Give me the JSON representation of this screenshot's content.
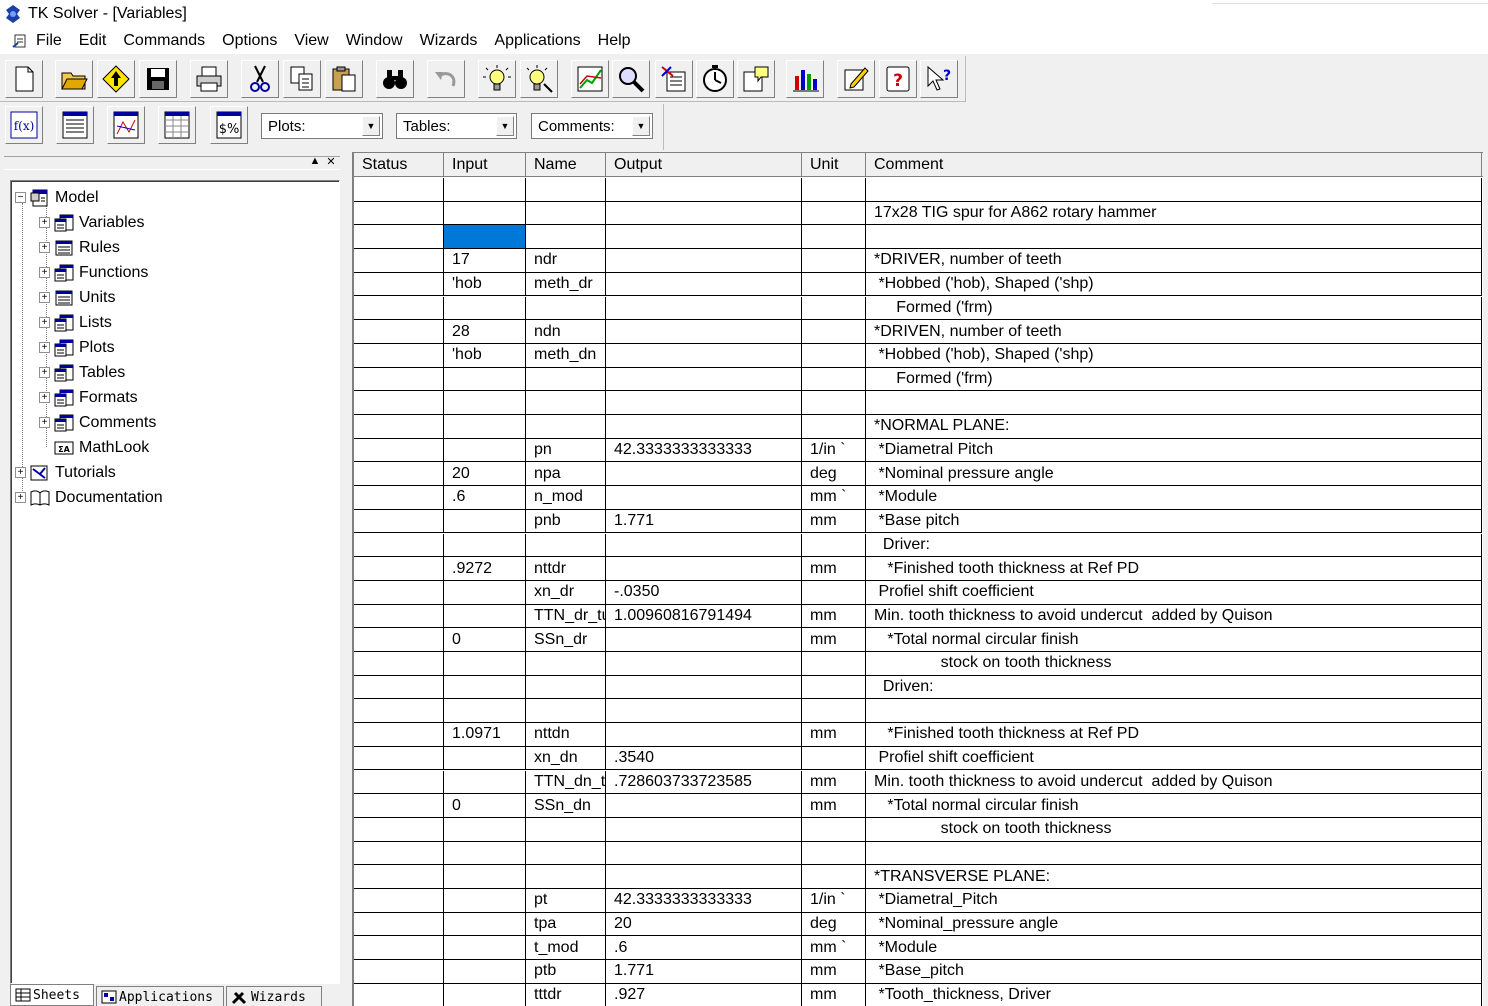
{
  "window": {
    "title": "TK Solver - [Variables]"
  },
  "menu": [
    "File",
    "Edit",
    "Commands",
    "Options",
    "View",
    "Window",
    "Wizards",
    "Applications",
    "Help"
  ],
  "toolbar": {
    "buttons": [
      "new-file-icon",
      "open-folder-icon",
      "up-arrow-icon",
      "save-icon",
      "print-icon",
      "cut-icon",
      "copy-icon",
      "paste-icon",
      "find-icon",
      "undo-icon",
      "solve-icon",
      "iterate-icon",
      "plot-icon",
      "zoom-icon",
      "list-icon",
      "timer-icon",
      "comment-icon",
      "chart-icon",
      "edit-icon",
      "help-icon",
      "context-help-icon"
    ]
  },
  "toolbar2": {
    "buttons": [
      "function-icon",
      "table-sheet-icon",
      "plot-sheet-icon",
      "blank-sheet-icon",
      "units-sheet-icon"
    ],
    "plots_combo": "Plots:",
    "tables_combo": "Tables:",
    "comments_combo": "Comments:"
  },
  "tree": {
    "root": "Model",
    "children": [
      "Variables",
      "Rules",
      "Functions",
      "Units",
      "Lists",
      "Plots",
      "Tables",
      "Formats",
      "Comments",
      "MathLook"
    ],
    "tutorials": "Tutorials",
    "documentation": "Documentation"
  },
  "tabs": {
    "sheets": "Sheets",
    "applications": "Applications",
    "wizards": "Wizards"
  },
  "sheet": {
    "columns": [
      "Status",
      "Input",
      "Name",
      "Output",
      "Unit",
      "Comment"
    ],
    "rows": [
      [
        "",
        "",
        "",
        "",
        "",
        ""
      ],
      [
        "",
        "",
        "",
        "",
        "",
        "17x28 TIG spur for A862 rotary hammer"
      ],
      [
        "",
        "",
        "",
        "",
        "",
        ""
      ],
      [
        "",
        "17",
        "ndr",
        "",
        "",
        "*DRIVER, number of teeth"
      ],
      [
        "",
        "'hob",
        "meth_dr",
        "",
        "",
        " *Hobbed ('hob), Shaped ('shp)"
      ],
      [
        "",
        "",
        "",
        "",
        "",
        "     Formed ('frm)"
      ],
      [
        "",
        "28",
        "ndn",
        "",
        "",
        "*DRIVEN, number of teeth"
      ],
      [
        "",
        "'hob",
        "meth_dn",
        "",
        "",
        " *Hobbed ('hob), Shaped ('shp)"
      ],
      [
        "",
        "",
        "",
        "",
        "",
        "     Formed ('frm)"
      ],
      [
        "",
        "",
        "",
        "",
        "",
        ""
      ],
      [
        "",
        "",
        "",
        "",
        "",
        "*NORMAL PLANE:"
      ],
      [
        "",
        "",
        "pn",
        "42.3333333333333",
        "1/in `",
        " *Diametral Pitch"
      ],
      [
        "",
        "20",
        "npa",
        "",
        "deg",
        " *Nominal pressure angle"
      ],
      [
        "",
        ".6",
        "n_mod",
        "",
        "mm `",
        " *Module"
      ],
      [
        "",
        "",
        "pnb",
        "1.771",
        "mm",
        " *Base pitch"
      ],
      [
        "",
        "",
        "",
        "",
        "",
        "  Driver:"
      ],
      [
        "",
        ".9272",
        "nttdr",
        "",
        "mm",
        "   *Finished tooth thickness at Ref PD"
      ],
      [
        "",
        "",
        "xn_dr",
        "-.0350",
        "",
        " Profiel shift coefficient"
      ],
      [
        "",
        "",
        "TTN_dr_tu",
        "1.00960816791494",
        "mm",
        "Min. tooth thickness to avoid undercut  added by Quison"
      ],
      [
        "",
        "0",
        "SSn_dr",
        "",
        "mm",
        "   *Total normal circular finish"
      ],
      [
        "",
        "",
        "",
        "",
        "",
        "               stock on tooth thickness"
      ],
      [
        "",
        "",
        "",
        "",
        "",
        "  Driven:"
      ],
      [
        "",
        "",
        "",
        "",
        "",
        ""
      ],
      [
        "",
        "1.0971",
        "nttdn",
        "",
        "mm",
        "   *Finished tooth thickness at Ref PD"
      ],
      [
        "",
        "",
        "xn_dn",
        ".3540",
        "",
        " Profiel shift coefficient"
      ],
      [
        "",
        "",
        "TTN_dn_tu",
        ".728603733723585",
        "mm",
        "Min. tooth thickness to avoid undercut  added by Quison"
      ],
      [
        "",
        "0",
        "SSn_dn",
        "",
        "mm",
        "   *Total normal circular finish"
      ],
      [
        "",
        "",
        "",
        "",
        "",
        "               stock on tooth thickness"
      ],
      [
        "",
        "",
        "",
        "",
        "",
        ""
      ],
      [
        "",
        "",
        "",
        "",
        "",
        "*TRANSVERSE PLANE:"
      ],
      [
        "",
        "",
        "pt",
        "42.3333333333333",
        "1/in `",
        " *Diametral_Pitch"
      ],
      [
        "",
        "",
        "tpa",
        "20",
        "deg",
        " *Nominal_pressure angle"
      ],
      [
        "",
        "",
        "t_mod",
        ".6",
        "mm `",
        " *Module"
      ],
      [
        "",
        "",
        "ptb",
        "1.771",
        "mm",
        " *Base_pitch"
      ],
      [
        "",
        "",
        "tttdr",
        ".927",
        "mm",
        " *Tooth_thickness, Driver"
      ]
    ],
    "selected": {
      "row": 2,
      "col": 1
    }
  }
}
